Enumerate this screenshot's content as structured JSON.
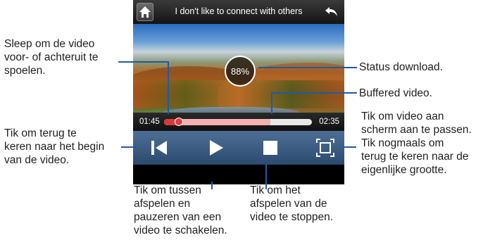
{
  "player": {
    "title": "I don't like to connect with others",
    "download_status": "88%",
    "elapsed_time": "01:45",
    "total_time": "02:35",
    "progress": {
      "played_fraction": 0.1,
      "buffered_fraction": 0.72
    },
    "icons": {
      "home": "home-icon",
      "back": "back-arrow-icon",
      "to_start": "skip-to-start-icon",
      "play": "play-icon",
      "stop": "stop-icon",
      "fit": "fit-to-screen-icon"
    }
  },
  "annotations": {
    "drag": [
      "Sleep om de video",
      "voor- of achteruit te",
      "spoelen."
    ],
    "download": [
      "Status download."
    ],
    "buffered": [
      "Buffered video."
    ],
    "to_start": [
      "Tik om terug te",
      "keren naar het begin",
      "van de video."
    ],
    "fit": [
      "Tik om video aan",
      "scherm aan te passen.",
      "Tik nogmaals om",
      "terug te keren naar de",
      "eigenlijke grootte."
    ],
    "play_pause": [
      "Tik om tussen",
      "afspelen en",
      "pauzeren van een",
      "video te schakelen."
    ],
    "stop": [
      "Tik om het",
      "afspelen van de",
      "video te stoppen."
    ]
  },
  "colors": {
    "callout_line": "#1f5aa8",
    "played_bar": "#d63a3a",
    "buffered_bar": "#f2b0b0",
    "controls_bar": "#3a5a85"
  }
}
